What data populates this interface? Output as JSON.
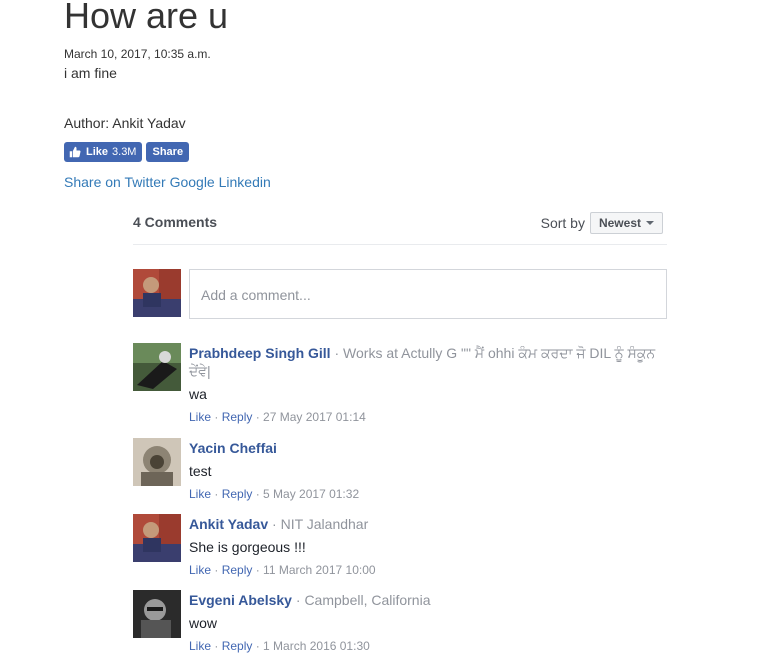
{
  "post": {
    "title": "How are u",
    "date": "March 10, 2017, 10:35 a.m.",
    "body": "i am fine",
    "author": "Author: Ankit Yadav"
  },
  "fb": {
    "like_label": "Like",
    "like_count": "3.3M",
    "share_label": "Share"
  },
  "share_links": [
    "Share on Twitter",
    "Google",
    "Linkedin"
  ],
  "comments_section": {
    "count_label": "4 Comments",
    "sort_label": "Sort by",
    "sort_value": "Newest",
    "input_placeholder": "Add a comment..."
  },
  "comments": [
    {
      "name": "Prabhdeep Singh Gill",
      "meta": "Works at Actully G \"\" ਮੈਂ ohhi ਕੰਮ ਕਰਦਾ ਜੋ DIL ਨੂੰ ਸੰਕੂਨ ਦੇਂਵੇ|",
      "text": "wa",
      "like": "Like",
      "reply": "Reply",
      "time": "27 May 2017 01:14"
    },
    {
      "name": "Yacin Cheffai",
      "meta": "",
      "text": "test",
      "like": "Like",
      "reply": "Reply",
      "time": "5 May 2017 01:32"
    },
    {
      "name": "Ankit Yadav",
      "meta": "NIT Jalandhar",
      "text": "She is gorgeous !!!",
      "like": "Like",
      "reply": "Reply",
      "time": "11 March 2017 10:00"
    },
    {
      "name": "Evgeni Abelsky",
      "meta": "Campbell, California",
      "text": "wow",
      "like": "Like",
      "reply": "Reply",
      "time": "1 March 2016 01:30"
    }
  ],
  "colors": {
    "facebook_blue": "#4267b2",
    "link_blue": "#337ab7",
    "name_blue": "#365899",
    "meta_gray": "#90949c"
  }
}
